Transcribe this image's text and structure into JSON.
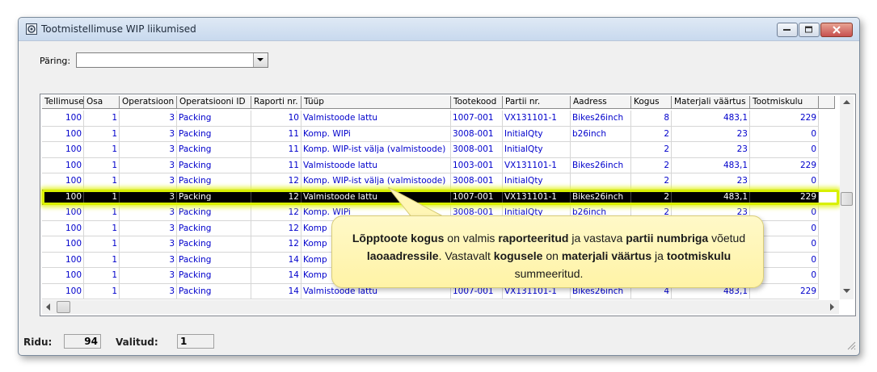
{
  "window": {
    "title": "Tootmistellimuse WIP liikumised"
  },
  "query": {
    "label": "Päring:",
    "value": ""
  },
  "table": {
    "columns": [
      "Tellimuse",
      "Osa",
      "Operatsioon",
      "Operatsiooni ID",
      "Raporti nr.",
      "Tüüp",
      "Tootekood",
      "Partii nr.",
      "Aadress",
      "Kogus",
      "Materjali väärtus",
      "Tootmiskulu"
    ],
    "rows": [
      [
        "100",
        "1",
        "3",
        "Packing",
        "10",
        "Valmistoode lattu",
        "1007-001",
        "VX131101-1",
        "Bikes26inch",
        "8",
        "483,1",
        "229"
      ],
      [
        "100",
        "1",
        "3",
        "Packing",
        "11",
        "Komp. WIPi",
        "3008-001",
        "InitialQty",
        "b26inch",
        "2",
        "23",
        "0"
      ],
      [
        "100",
        "1",
        "3",
        "Packing",
        "11",
        "Komp. WIP-ist välja (valmistoode)",
        "3008-001",
        "InitialQty",
        "",
        "2",
        "23",
        "0"
      ],
      [
        "100",
        "1",
        "3",
        "Packing",
        "11",
        "Valmistoode lattu",
        "1003-001",
        "VX131101-1",
        "Bikes26inch",
        "2",
        "483,1",
        "229"
      ],
      [
        "100",
        "1",
        "3",
        "Packing",
        "12",
        "Komp. WIP-ist välja (valmistoode)",
        "3008-001",
        "InitialQty",
        "",
        "2",
        "23",
        "0"
      ],
      [
        "100",
        "1",
        "3",
        "Packing",
        "12",
        "Valmistoode lattu",
        "1007-001",
        "VX131101-1",
        "Bikes26inch",
        "2",
        "483,1",
        "229"
      ],
      [
        "100",
        "1",
        "3",
        "Packing",
        "12",
        "Komp. WIPi",
        "3008-001",
        "InitialQty",
        "b26inch",
        "2",
        "23",
        "0"
      ],
      [
        "100",
        "1",
        "3",
        "Packing",
        "12",
        "Komp",
        "",
        "",
        "",
        "",
        "",
        "0"
      ],
      [
        "100",
        "1",
        "3",
        "Packing",
        "12",
        "Komp",
        "",
        "",
        "",
        "",
        "",
        "0"
      ],
      [
        "100",
        "1",
        "3",
        "Packing",
        "14",
        "Komp",
        "",
        "",
        "",
        "",
        "",
        "0"
      ],
      [
        "100",
        "1",
        "3",
        "Packing",
        "14",
        "Komp",
        "",
        "",
        "",
        "",
        "",
        "0"
      ],
      [
        "100",
        "1",
        "3",
        "Packing",
        "14",
        "Valmistoode lattu",
        "1007-001",
        "VX131101-1",
        "Bikes26inch",
        "4",
        "483,1",
        "229"
      ]
    ],
    "selected_row": 5
  },
  "status": {
    "rows_label": "Ridu:",
    "rows_value": "94",
    "selected_label": "Valitud:",
    "selected_value": "1"
  },
  "callout": {
    "parts": [
      {
        "t": "Lõpptoote kogus",
        "b": true
      },
      {
        "t": " on valmis ",
        "b": false
      },
      {
        "t": "raporteeritud",
        "b": true
      },
      {
        "t": " ja vastava ",
        "b": false
      },
      {
        "t": "partii numbriga",
        "b": true
      },
      {
        "t": " võetud ",
        "b": false
      },
      {
        "t": "laoaadressile",
        "b": true
      },
      {
        "t": ". Vastavalt ",
        "b": false
      },
      {
        "t": "kogusele",
        "b": true
      },
      {
        "t": " on ",
        "b": false
      },
      {
        "t": "materjali väärtus",
        "b": true
      },
      {
        "t": " ja ",
        "b": false
      },
      {
        "t": "tootmiskulu",
        "b": true
      },
      {
        "t": " summeeritud.",
        "b": false
      }
    ]
  },
  "colors": {
    "cell_text": "#0000cc",
    "selection_bg": "#000000",
    "selection_glow": "#d8f000",
    "callout_bg": "#fff6b5"
  }
}
